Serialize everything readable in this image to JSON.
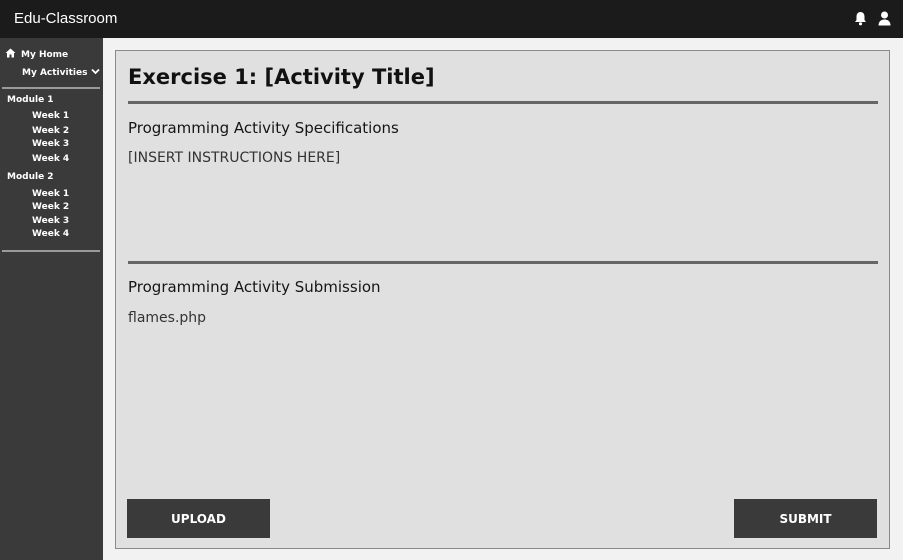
{
  "app": {
    "title": "Edu-Classroom"
  },
  "header_icons": [
    "bell-icon",
    "user-icon"
  ],
  "sidebar": {
    "home_label": "My Home",
    "activities_label": "My Activities",
    "modules": [
      {
        "label": "Module 1",
        "weeks": [
          "Week 1",
          "Week 2",
          "Week 3",
          "Week 4"
        ]
      },
      {
        "label": "Module 2",
        "weeks": [
          "Week 1",
          "Week 2",
          "Week 3",
          "Week 4"
        ]
      }
    ]
  },
  "exercise": {
    "title": "Exercise 1: [Activity Title]",
    "spec_heading": "Programming Activity Specifications",
    "instructions": "[INSERT INSTRUCTIONS HERE]",
    "submission_heading": "Programming Activity Submission",
    "file_name": "flames.php"
  },
  "buttons": {
    "upload": "UPLOAD",
    "submit": "SUBMIT"
  },
  "colors": {
    "topbar": "#1b1b1b",
    "sidebar": "#3a3a3a",
    "panel": "#e0e0e0",
    "button": "#3a3a3a"
  }
}
